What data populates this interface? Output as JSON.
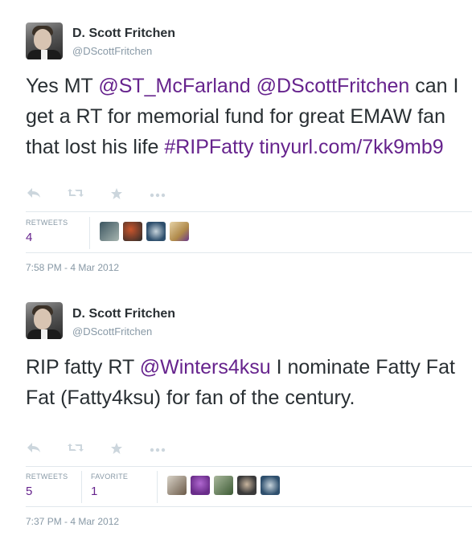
{
  "tweets": [
    {
      "author_name": "D. Scott Fritchen",
      "author_handle": "@DScottFritchen",
      "text_parts": [
        {
          "t": "Yes MT ",
          "link": false
        },
        {
          "t": "@ST_McFarland",
          "link": true
        },
        {
          "t": " ",
          "link": false
        },
        {
          "t": "@DScottFritchen",
          "link": true
        },
        {
          "t": " can I get a RT for memorial fund for great EMAW fan that lost his life ",
          "link": false
        },
        {
          "t": "#RIPFatty",
          "link": true
        },
        {
          "t": " ",
          "link": false
        },
        {
          "t": "tinyurl.com/7kk9mb9",
          "link": true
        }
      ],
      "actions": [
        "reply-icon",
        "retweet-icon",
        "favorite-icon",
        "more-icon"
      ],
      "stats": [
        {
          "label": "RETWEETS",
          "value": "4"
        }
      ],
      "engagers": [
        "#3b5560",
        "#7a3b2c",
        "#2e4f6d",
        "#b08a4a"
      ],
      "timestamp": "7:58 PM - 4 Mar 2012"
    },
    {
      "author_name": "D. Scott Fritchen",
      "author_handle": "@DScottFritchen",
      "text_parts": [
        {
          "t": "RIP fatty RT ",
          "link": false
        },
        {
          "t": "@Winters4ksu",
          "link": true
        },
        {
          "t": " I nominate Fatty Fat Fat (Fatty4ksu) for fan of the century.",
          "link": false
        }
      ],
      "actions": [
        "reply-icon",
        "retweet-icon",
        "favorite-icon",
        "more-icon"
      ],
      "stats": [
        {
          "label": "RETWEETS",
          "value": "5"
        },
        {
          "label": "FAVORITE",
          "value": "1"
        }
      ],
      "engagers": [
        "#6b5a48",
        "#6a2d8a",
        "#3c5a34",
        "#3a3a3a",
        "#2e4f6d"
      ],
      "timestamp": "7:37 PM - 4 Mar 2012"
    }
  ],
  "colors": {
    "link": "#66238d",
    "muted": "#8899a6",
    "divider": "#e1e8ed",
    "icon": "#ccd6dd"
  }
}
